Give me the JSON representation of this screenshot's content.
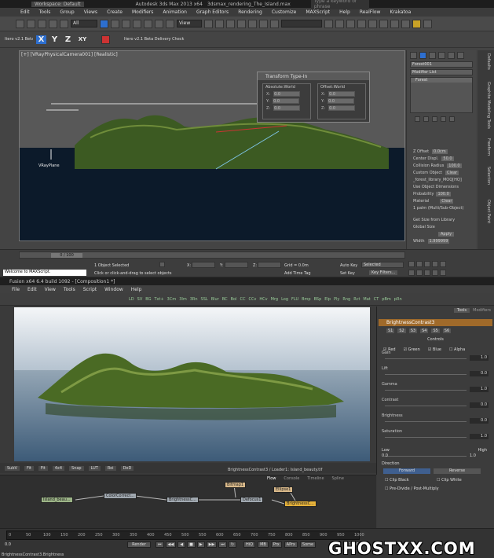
{
  "max": {
    "title": "Autodesk 3ds Max 2013 x64",
    "file": "3dsmax_rendering_The_Island.max",
    "workspace": "Workspace: Default",
    "search_placeholder": "Type a keyword or phrase",
    "menu": [
      "Edit",
      "Tools",
      "Group",
      "Views",
      "Create",
      "Modifiers",
      "Animation",
      "Graph Editors",
      "Rendering",
      "Customize",
      "MAXScript",
      "Help",
      "RealFlow",
      "Krakatoa"
    ],
    "selection_filter": "All",
    "ref_coord": "View",
    "plugin_left": "Itero v2.1 Beta",
    "plugin_right": "Itero v2.1 Beta Delivery Check",
    "axes": [
      "X",
      "Y",
      "Z",
      "XY"
    ],
    "viewport_label": "[+] [VRayPhysicalCamera001] [Realistic]",
    "vrayplane": "VRayPlane",
    "transform": {
      "title": "Transform Type-In",
      "absolute": "Absolute:World",
      "offset": "Offset:World",
      "abs_values": [
        "0.0",
        "0.0",
        "0.0"
      ],
      "off_values": [
        "0.0",
        "0.0",
        "0.0"
      ]
    },
    "cmd": {
      "object_name": "Forest001",
      "modifier_list": "Modifier List",
      "stack_item": "Forest",
      "z_offset_label": "Z Offset",
      "z_offset": "0.0cm",
      "center_displ_label": "Center Displ.",
      "center_displ": "50.0",
      "collision_label": "Collision Radius",
      "collision": "100.0",
      "custom_object": "Custom Object",
      "clear": "Clear",
      "forest_lib": "_forest_library_MOQ[HQ]",
      "use_obj_dims": "Use Object Dimensions",
      "probability_label": "Probability",
      "probability": "100.0",
      "material_label": "Material",
      "material": "1 palm (Multi/Sub-Object)",
      "get_size": "Get Size from Library",
      "global_size": "Global Size",
      "apply": "Apply",
      "width_label": "Width",
      "width": "1.999999"
    },
    "vtabs": [
      "Defaults",
      "Graphite Modeling Tools",
      "Freeform",
      "Selection",
      "Object Paint"
    ],
    "status": {
      "frames": "0 / 100",
      "selected": "1 Object Selected",
      "hint": "Click or click-and-drag to select objects",
      "maxscript": "Welcome to MAXScript.",
      "x_label": "X:",
      "y_label": "Y:",
      "z_label": "Z:",
      "grid": "Grid = 0.0m",
      "add_time_tag": "Add Time Tag",
      "auto_key": "Auto Key",
      "selected_dd": "Selected",
      "set_key": "Set Key",
      "key_filters": "Key Filters..."
    }
  },
  "fusion": {
    "title": "Fusion x64 6.4 build 1092 - [Composition1 *]",
    "menu": [
      "File",
      "Edit",
      "View",
      "Tools",
      "Script",
      "Window",
      "Help"
    ],
    "toolbar": [
      "LD",
      "SV",
      "BG",
      "Txt+",
      "3Cm",
      "3Im",
      "3Rn",
      "SSL",
      "Blur",
      "BC",
      "Bol",
      "CC",
      "CCv",
      "HCv",
      "Mrg",
      "Log",
      "FLU",
      "Bmp",
      "BSp",
      "Elp",
      "Ply",
      "Rng",
      "Rct",
      "Mat",
      "CT",
      "pBm",
      "pRn"
    ],
    "tools_tab": "Tools",
    "modifiers_tab": "Modifiers",
    "node_title": "BrightnessContrast3",
    "channels": [
      "S1",
      "S2",
      "S3",
      "S4",
      "S5",
      "S6"
    ],
    "controls_tab": "Controls",
    "rgb": [
      "Red",
      "Green",
      "Blue",
      "Alpha"
    ],
    "params": [
      {
        "name": "Gain",
        "value": "1.0"
      },
      {
        "name": "Lift",
        "value": "0.0"
      },
      {
        "name": "Gamma",
        "value": "1.0"
      },
      {
        "name": "Contrast",
        "value": "0.0"
      },
      {
        "name": "Brightness",
        "value": "0.0"
      },
      {
        "name": "Saturation",
        "value": "1.0"
      }
    ],
    "low": "Low",
    "high": "High",
    "low_val": "0.0",
    "high_val": "1.0",
    "direction": "Direction",
    "forward": "Forward",
    "reverse": "Reverse",
    "clip_black": "Clip Black",
    "clip_white": "Clip White",
    "pre_divide": "Pre-Divide / Post-Multiply",
    "viewer_bar": [
      "SubV",
      "Fit",
      "Fit",
      "4x4",
      "Snap",
      "LUT",
      "Roi",
      "DoD"
    ],
    "flow_tabs": [
      "Flow",
      "Console",
      "Timeline",
      "Spline"
    ],
    "flow_path": "BrightnessContrast3 / Loader1: Island_beauty.tif",
    "nodes": [
      "Island_beau...",
      "ColorCorrect...",
      "BrightnessC...",
      "Defocus1",
      "BrightnessC...",
      "Bitmap1",
      "Ellipse1"
    ],
    "ruler": [
      "0",
      "50",
      "100",
      "150",
      "200",
      "250",
      "300",
      "350",
      "400",
      "450",
      "500",
      "550",
      "600",
      "650",
      "700",
      "750",
      "800",
      "850",
      "900",
      "950",
      "1000"
    ],
    "render": "Render",
    "hiq": "HiQ",
    "mb": "MB",
    "prx": "Prx",
    "aprx": "APrx",
    "some": "Some",
    "time_start": "0.0",
    "time_end": "1000.0",
    "status_left": "BrightnessContrast3.Brightness"
  },
  "watermark": "GHOSTXX.COM"
}
